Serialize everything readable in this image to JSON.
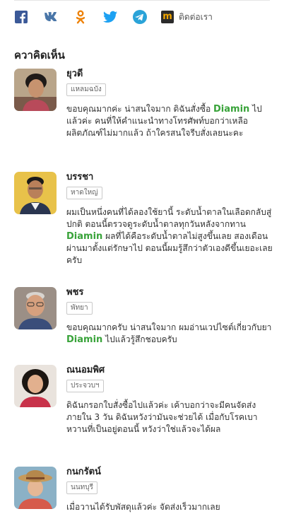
{
  "share": {
    "items": [
      {
        "icon": "facebook-icon",
        "color": "#3b5998"
      },
      {
        "icon": "vk-icon",
        "color": "#4a76a8"
      },
      {
        "icon": "odnoklassniki-icon",
        "color": "#ee8208"
      },
      {
        "icon": "twitter-icon",
        "color": "#1da1f2"
      },
      {
        "icon": "telegram-icon",
        "color": "#2aa3d8"
      }
    ],
    "contact_label": "ติดต่อเรา"
  },
  "comments_title": "ควาคิดเห็น",
  "brand_color": "#39a33a",
  "comments": [
    {
      "name": "ยุวดี",
      "location": "แหลมฉบัง",
      "pre": "ขอบคุณมากค่ะ น่าสนใจมาก ดิฉันสั่งซื้อ ",
      "brand": "Diamin",
      "post": " ไปแล้วค่ะ คนที่ให้คำแนะนำทางโทรศัพท์บอกว่าเหลือผลิตภัณฑ์ไม่มากแล้ว ถ้าใครสนใจรีบสั่งเลยนะคะ"
    },
    {
      "name": "บรรชา",
      "location": "หาดใหญ่",
      "pre": "ผมเป็นหนึ่งคนที่ได้ลองใช้ยานี้ ระดับน้ำตาลในเลือดกลับสู่ปกติ ตอนนี้ตรวจดูระดับน้ำตาลทุกวันหลังจากทาน ",
      "brand": "Diamin",
      "post": " ผลที่ได้คือระดับน้ำตาลไม่สูงขึ้นเลย สองเดือนผ่านมาตั้งแต่รักษาไป ตอนนี้ผมรู้สึกว่าตัวเองดีขึ้นเยอะเลยครับ"
    },
    {
      "name": "พชร",
      "location": "พัทยา",
      "pre": "ขอบคุณมากครับ น่าสนใจมาก ผมอ่านเวปไซต์เกี่ยวกับยา ",
      "brand": "Diamin",
      "post": " ไปแล้วรู้สึกชอบครับ"
    },
    {
      "name": "ณนอมพิศ",
      "location": "ประจวบฯ",
      "pre": "ดิฉันกรอกใบสั่งซื้อไปแล้วค่ะ เค้าบอกว่าจะมีคนจัดส่งภายใน 3 วัน ดิฉันหวังว่ามันจะช่วยได้ เมื่อกับโรคเบาหวานที่เป็นอยู่ตอนนี้ หวังว่าใช่แล้วจะได้ผล",
      "brand": "",
      "post": ""
    },
    {
      "name": "กนกรัตน์",
      "location": "นนทบุรี",
      "pre": "เมื่อวานได้รับพัสดุแล้วค่ะ จัดส่งเร็วมากเลย",
      "brand": "",
      "post": ""
    }
  ]
}
